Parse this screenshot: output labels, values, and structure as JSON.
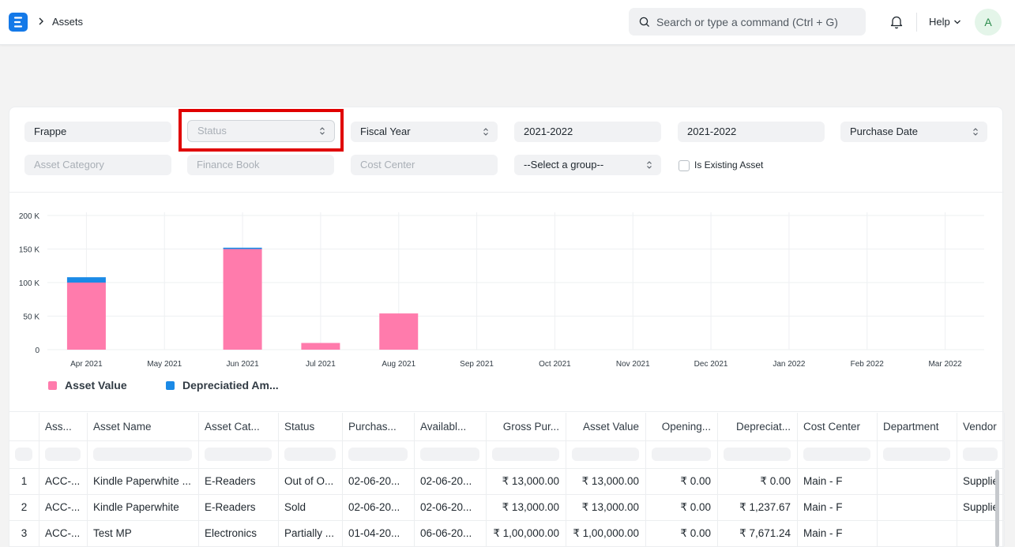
{
  "navbar": {
    "breadcrumb": "Assets",
    "search_placeholder": "Search or type a command (Ctrl + G)",
    "help_label": "Help",
    "avatar_initial": "A",
    "icons": [
      "app-logo",
      "chevron-right-icon",
      "search-icon",
      "bell-icon",
      "chevron-down-icon"
    ]
  },
  "filters": {
    "company": "Frappe",
    "status": "Status",
    "filter_based_on": "Fiscal Year",
    "from_fiscal_year": "2021-2022",
    "to_fiscal_year": "2021-2022",
    "date_based_on": "Purchase Date",
    "asset_category": "Asset Category",
    "finance_book": "Finance Book",
    "cost_center": "Cost Center",
    "group_by": "--Select a group--",
    "is_existing_asset": "Is Existing Asset"
  },
  "chart_data": {
    "type": "bar",
    "stacked": true,
    "categories": [
      "Apr 2021",
      "May 2021",
      "Jun 2021",
      "Jul 2021",
      "Aug 2021",
      "Sep 2021",
      "Oct 2021",
      "Nov 2021",
      "Dec 2021",
      "Jan 2022",
      "Feb 2022",
      "Mar 2022"
    ],
    "series": [
      {
        "name": "Asset Value",
        "color": "#ff7bac",
        "values": [
          100000,
          0,
          150000,
          10000,
          54000,
          0,
          0,
          0,
          0,
          0,
          0,
          0
        ]
      },
      {
        "name": "Depreciatied Am...",
        "color": "#1b8ae6",
        "values": [
          8000,
          0,
          2000,
          0,
          0,
          0,
          0,
          0,
          0,
          0,
          0,
          0
        ]
      }
    ],
    "y_ticks": [
      "0",
      "50 K",
      "100 K",
      "150 K",
      "200 K"
    ],
    "ylim": [
      0,
      200000
    ],
    "grid": true,
    "legend_position": "bottom-left"
  },
  "table": {
    "columns": [
      "Ass...",
      "Asset Name",
      "Asset Cat...",
      "Status",
      "Purchas...",
      "Availabl...",
      "Gross Pur...",
      "Asset Value",
      "Opening...",
      "Depreciat...",
      "Cost Center",
      "Department",
      "Vendor"
    ],
    "rows": [
      {
        "idx": "1",
        "cells": [
          "ACC-...",
          "Kindle Paperwhite ...",
          "E-Readers",
          "Out of O...",
          "02-06-20...",
          "02-06-20...",
          "₹ 13,000.00",
          "₹ 13,000.00",
          "₹ 0.00",
          "₹ 0.00",
          "Main - F",
          "",
          "Supplie"
        ]
      },
      {
        "idx": "2",
        "cells": [
          "ACC-...",
          "Kindle Paperwhite",
          "E-Readers",
          "Sold",
          "02-06-20...",
          "02-06-20...",
          "₹ 13,000.00",
          "₹ 13,000.00",
          "₹ 0.00",
          "₹ 1,237.67",
          "Main - F",
          "",
          "Supplie"
        ]
      },
      {
        "idx": "3",
        "cells": [
          "ACC-...",
          "Test MP",
          "Electronics",
          "Partially ...",
          "01-04-20...",
          "06-06-20...",
          "₹ 1,00,000.00",
          "₹ 1,00,000.00",
          "₹ 0.00",
          "₹ 7,671.24",
          "Main - F",
          "",
          ""
        ]
      }
    ]
  }
}
